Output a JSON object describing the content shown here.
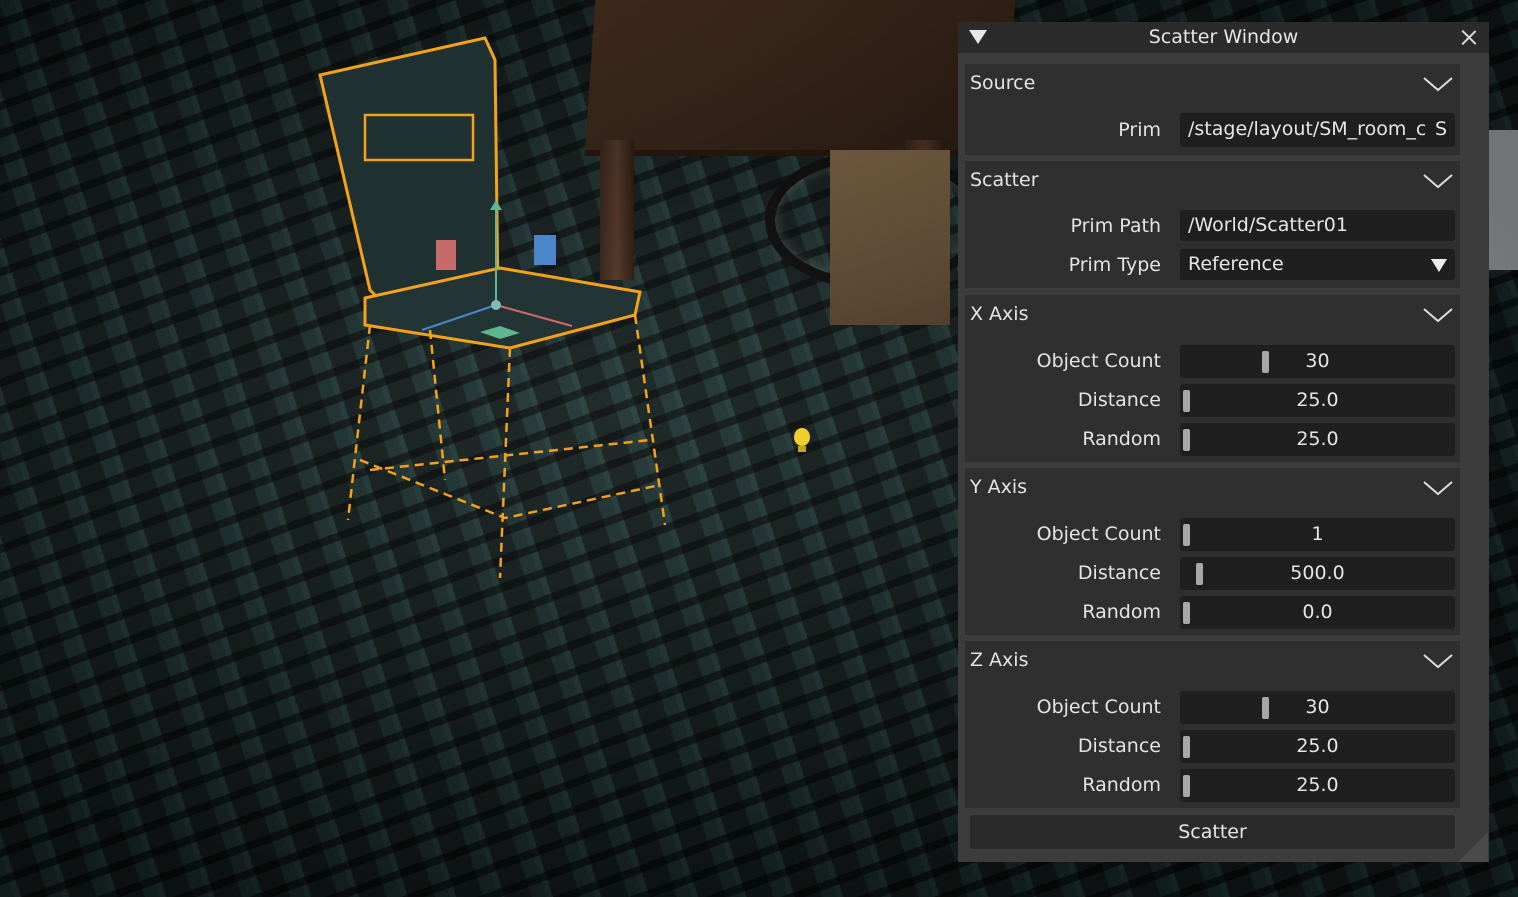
{
  "window": {
    "title": "Scatter Window"
  },
  "source": {
    "title": "Source",
    "prim_label": "Prim",
    "prim_value": "/stage/layout/SM_room_cl",
    "prim_suffix": "S"
  },
  "scatter": {
    "title": "Scatter",
    "prim_path_label": "Prim Path",
    "prim_path_value": "/World/Scatter01",
    "prim_type_label": "Prim Type",
    "prim_type_value": "Reference"
  },
  "axes": [
    {
      "title": "X Axis",
      "object_count_label": "Object Count",
      "object_count": "30",
      "object_count_fraction": 0.3,
      "distance_label": "Distance",
      "distance": "25.0",
      "distance_fraction": 0.0,
      "random_label": "Random",
      "random": "25.0",
      "random_fraction": 0.0
    },
    {
      "title": "Y Axis",
      "object_count_label": "Object Count",
      "object_count": "1",
      "object_count_fraction": 0.0,
      "distance_label": "Distance",
      "distance": "500.0",
      "distance_fraction": 0.05,
      "random_label": "Random",
      "random": "0.0",
      "random_fraction": 0.0
    },
    {
      "title": "Z Axis",
      "object_count_label": "Object Count",
      "object_count": "30",
      "object_count_fraction": 0.3,
      "distance_label": "Distance",
      "distance": "25.0",
      "distance_fraction": 0.0,
      "random_label": "Random",
      "random": "25.0",
      "random_fraction": 0.0
    }
  ],
  "actions": {
    "scatter_button": "Scatter"
  },
  "colors": {
    "selection_outline": "#f5a21b",
    "gizmo_y": "#5fb58e",
    "gizmo_x": "#d06a6a",
    "gizmo_z": "#4a86c9",
    "light_icon": "#f2cd2e"
  },
  "icons": {
    "window_collapse": "triangle-down-icon",
    "window_close": "close-icon",
    "section_toggle": "chevron-down-icon",
    "dropdown": "triangle-down-icon",
    "scene_light": "light-bulb-icon"
  }
}
